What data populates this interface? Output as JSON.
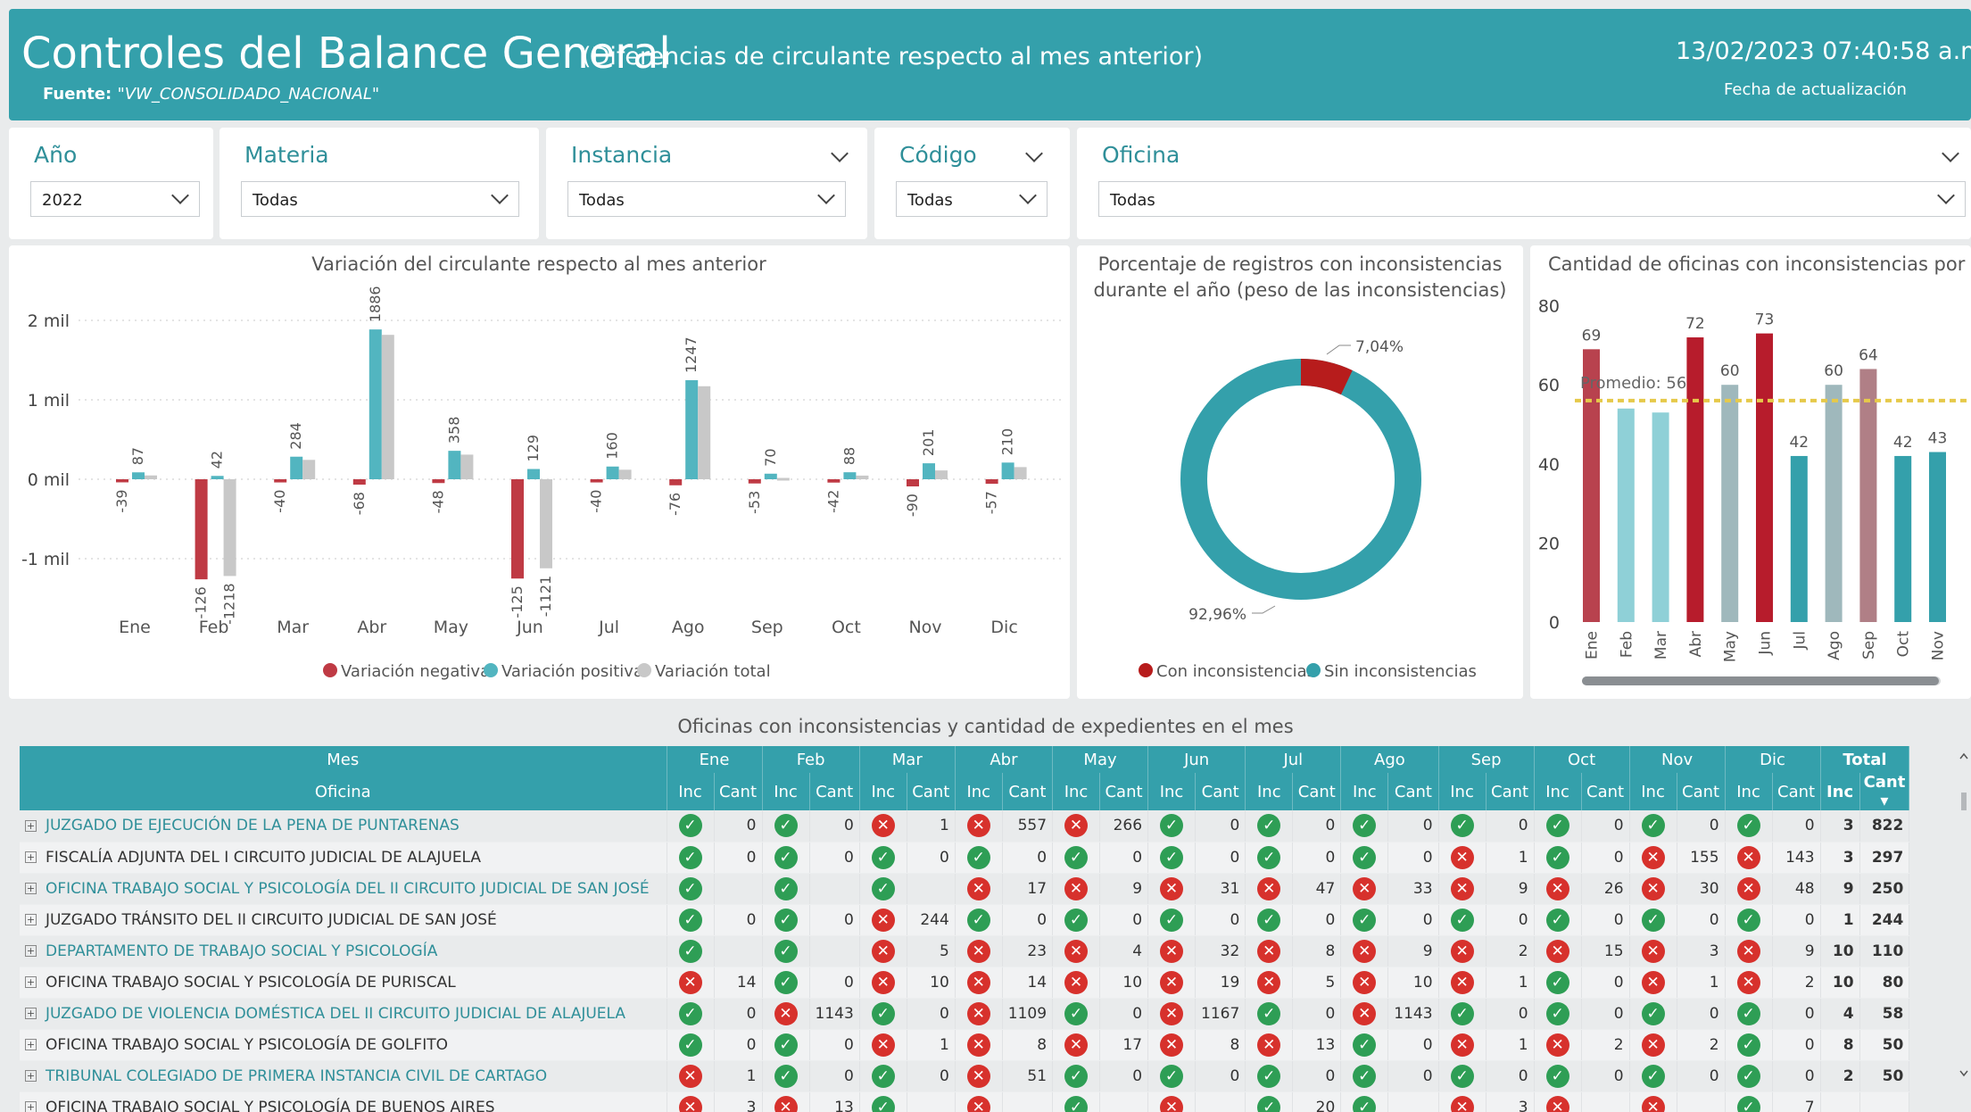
{
  "header": {
    "title": "Controles del Balance General",
    "subtitle": "(Diferencias de circulante respecto al mes anterior)",
    "source_label": "Fuente:",
    "source_value": "\"VW_CONSOLIDADO_NACIONAL\"",
    "datetime": "13/02/2023 07:40:58 a.m.",
    "datetime_label": "Fecha de actualización"
  },
  "slicers": [
    {
      "label": "Año",
      "value": "2022"
    },
    {
      "label": "Materia",
      "value": "Todas"
    },
    {
      "label": "Instancia",
      "value": "Todas"
    },
    {
      "label": "Código",
      "value": "Todas"
    },
    {
      "label": "Oficina",
      "value": "Todas"
    }
  ],
  "colors": {
    "accent": "#34a0ab",
    "negative": "#bf3a44",
    "positive": "#52b5c0",
    "total": "#c8c8c8",
    "inconsistent": "#b71c1c",
    "ok": "#2e9e55",
    "bad": "#d7312c"
  },
  "chart_data": [
    {
      "type": "bar",
      "title": "Variación del circulante respecto al mes anterior",
      "categories": [
        "Ene",
        "Feb",
        "Mar",
        "Abr",
        "May",
        "Jun",
        "Jul",
        "Ago",
        "Sep",
        "Oct",
        "Nov",
        "Dic"
      ],
      "y_ticks": [
        "2 mil",
        "1 mil",
        "0 mil",
        "-1 mil"
      ],
      "series": [
        {
          "name": "Variación negativa",
          "values": [
            -39,
            -1260,
            -40,
            -68,
            -48,
            -1250,
            -40,
            -76,
            -53,
            -42,
            -90,
            -57
          ],
          "labels": [
            "-39",
            "-126",
            "-40",
            "-68",
            "-48",
            "-125",
            "-40",
            "-76",
            "-53",
            "-42",
            "-90",
            "-57"
          ]
        },
        {
          "name": "Variación positiva",
          "values": [
            87,
            42,
            284,
            1886,
            358,
            129,
            160,
            1247,
            70,
            88,
            201,
            210
          ]
        },
        {
          "name": "Variación total",
          "values": [
            48,
            -1218,
            244,
            1818,
            310,
            -1121,
            120,
            1171,
            17,
            46,
            111,
            153
          ],
          "labels": [
            "",
            "-1218",
            "",
            "",
            "",
            "-1121",
            "",
            "",
            "",
            "",
            "",
            ""
          ]
        }
      ],
      "legend": "bottom"
    },
    {
      "type": "pie",
      "title": "Porcentaje de registros con inconsistencias durante el año (peso de las inconsistencias)",
      "slices": [
        {
          "name": "Con inconsistencias",
          "value": 7.04,
          "label": "7,04%"
        },
        {
          "name": "Sin inconsistencias",
          "value": 92.96,
          "label": "92,96%"
        }
      ],
      "legend": "bottom"
    },
    {
      "type": "bar",
      "title": "Cantidad de oficinas con inconsistencias por mes",
      "categories": [
        "Ene",
        "Feb",
        "Mar",
        "Abr",
        "May",
        "Jun",
        "Jul",
        "Ago",
        "Sep",
        "Oct",
        "Nov"
      ],
      "values": [
        69,
        54,
        53,
        72,
        60,
        73,
        42,
        60,
        64,
        42,
        43
      ],
      "value_labels": [
        "69",
        "",
        "",
        "72",
        "60",
        "73",
        "42",
        "60",
        "64",
        "42",
        "43"
      ],
      "bar_colors": [
        "#b8424e",
        "#8fd0d7",
        "#8fd0d7",
        "#b71c2c",
        "#9fb8bc",
        "#b71c2c",
        "#34a0ab",
        "#9fb8bc",
        "#b07f86",
        "#34a0ab",
        "#34a0ab"
      ],
      "average": 56,
      "average_label": "Promedio: 56",
      "ylim": [
        0,
        80
      ],
      "y_ticks": [
        "80",
        "60",
        "40",
        "20",
        "0"
      ]
    }
  ],
  "table": {
    "title": "Oficinas con inconsistencias y cantidad de expedientes en el mes",
    "header_row1": "Mes",
    "header_row2": "Oficina",
    "months": [
      "Ene",
      "Feb",
      "Mar",
      "Abr",
      "May",
      "Jun",
      "Jul",
      "Ago",
      "Sep",
      "Oct",
      "Nov",
      "Dic"
    ],
    "total_label": "Total",
    "sub_inc": "Inc",
    "sub_cant": "Cant",
    "rows": [
      {
        "office": "JUZGADO DE EJECUCIÓN DE LA PENA DE PUNTARENAS",
        "link": true,
        "status": [
          "ok",
          "ok",
          "bad",
          "bad",
          "bad",
          "ok",
          "ok",
          "ok",
          "ok",
          "ok",
          "ok",
          "ok"
        ],
        "cant": [
          "0",
          "0",
          "1",
          "557",
          "266",
          "0",
          "0",
          "0",
          "0",
          "0",
          "0",
          "0"
        ],
        "inc": "3",
        "total": "822"
      },
      {
        "office": "FISCALÍA ADJUNTA DEL I CIRCUITO JUDICIAL DE ALAJUELA",
        "link": false,
        "status": [
          "ok",
          "ok",
          "ok",
          "ok",
          "ok",
          "ok",
          "ok",
          "ok",
          "bad",
          "ok",
          "bad",
          "bad"
        ],
        "cant": [
          "0",
          "0",
          "0",
          "0",
          "0",
          "0",
          "0",
          "0",
          "1",
          "0",
          "155",
          "143"
        ],
        "inc": "3",
        "total": "297"
      },
      {
        "office": "OFICINA TRABAJO SOCIAL Y PSICOLOGÍA DEL II CIRCUITO JUDICIAL DE SAN JOSÉ",
        "link": true,
        "status": [
          "ok",
          "ok",
          "ok",
          "bad",
          "bad",
          "bad",
          "bad",
          "bad",
          "bad",
          "bad",
          "bad",
          "bad"
        ],
        "cant": [
          "",
          "",
          "",
          "17",
          "9",
          "31",
          "47",
          "33",
          "9",
          "26",
          "30",
          "48"
        ],
        "inc": "9",
        "total": "250"
      },
      {
        "office": "JUZGADO TRÁNSITO DEL II CIRCUITO JUDICIAL DE SAN JOSÉ",
        "link": false,
        "status": [
          "ok",
          "ok",
          "bad",
          "ok",
          "ok",
          "ok",
          "ok",
          "ok",
          "ok",
          "ok",
          "ok",
          "ok"
        ],
        "cant": [
          "0",
          "0",
          "244",
          "0",
          "0",
          "0",
          "0",
          "0",
          "0",
          "0",
          "0",
          "0"
        ],
        "inc": "1",
        "total": "244"
      },
      {
        "office": "DEPARTAMENTO DE TRABAJO SOCIAL Y PSICOLOGÍA",
        "link": true,
        "status": [
          "ok",
          "ok",
          "bad",
          "bad",
          "bad",
          "bad",
          "bad",
          "bad",
          "bad",
          "bad",
          "bad",
          "bad"
        ],
        "cant": [
          "",
          "",
          "5",
          "23",
          "4",
          "32",
          "8",
          "9",
          "2",
          "15",
          "3",
          "9"
        ],
        "inc": "10",
        "total": "110"
      },
      {
        "office": "OFICINA TRABAJO SOCIAL Y PSICOLOGÍA DE PURISCAL",
        "link": false,
        "status": [
          "bad",
          "ok",
          "bad",
          "bad",
          "bad",
          "bad",
          "bad",
          "bad",
          "bad",
          "ok",
          "bad",
          "bad"
        ],
        "cant": [
          "14",
          "0",
          "10",
          "14",
          "10",
          "19",
          "5",
          "10",
          "1",
          "0",
          "1",
          "2"
        ],
        "inc": "10",
        "total": "80"
      },
      {
        "office": "JUZGADO DE VIOLENCIA DOMÉSTICA DEL II CIRCUITO JUDICIAL DE ALAJUELA",
        "link": true,
        "status": [
          "ok",
          "bad",
          "ok",
          "bad",
          "ok",
          "bad",
          "ok",
          "bad",
          "ok",
          "ok",
          "ok",
          "ok"
        ],
        "cant": [
          "0",
          "1143",
          "0",
          "1109",
          "0",
          "1167",
          "0",
          "1143",
          "0",
          "0",
          "0",
          "0"
        ],
        "inc": "4",
        "total": "58"
      },
      {
        "office": "OFICINA TRABAJO SOCIAL Y PSICOLOGÍA DE GOLFITO",
        "link": false,
        "status": [
          "ok",
          "ok",
          "bad",
          "bad",
          "bad",
          "bad",
          "bad",
          "ok",
          "bad",
          "bad",
          "bad",
          "ok"
        ],
        "cant": [
          "0",
          "0",
          "1",
          "8",
          "17",
          "8",
          "13",
          "0",
          "1",
          "2",
          "2",
          "0"
        ],
        "inc": "8",
        "total": "50"
      },
      {
        "office": "TRIBUNAL COLEGIADO DE PRIMERA INSTANCIA CIVIL DE CARTAGO",
        "link": true,
        "status": [
          "bad",
          "ok",
          "ok",
          "bad",
          "ok",
          "ok",
          "ok",
          "ok",
          "ok",
          "ok",
          "ok",
          "ok"
        ],
        "cant": [
          "1",
          "0",
          "0",
          "51",
          "0",
          "0",
          "0",
          "0",
          "0",
          "0",
          "0",
          "0"
        ],
        "inc": "2",
        "total": "50"
      },
      {
        "office": "OFICINA TRABAJO SOCIAL Y PSICOLOGÍA DE BUENOS AIRES",
        "link": false,
        "status": [
          "bad",
          "bad",
          "ok",
          "bad",
          "ok",
          "bad",
          "ok",
          "ok",
          "bad",
          "bad",
          "bad",
          "ok"
        ],
        "cant": [
          "3",
          "13",
          "",
          "",
          "",
          "",
          "20",
          "",
          "3",
          "",
          "",
          "7"
        ],
        "inc": "",
        "total": ""
      }
    ]
  }
}
